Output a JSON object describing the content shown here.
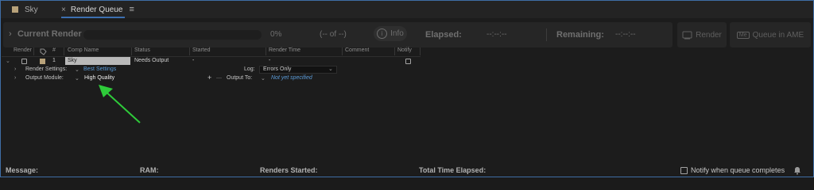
{
  "tabs": [
    {
      "label": "Sky"
    },
    {
      "label": "Render Queue"
    }
  ],
  "current_render": {
    "title": "Current Render",
    "percent": "0%",
    "of": "(-- of --)",
    "info_label": "Info",
    "elapsed_label": "Elapsed:",
    "elapsed_value": "--:--:--",
    "remaining_label": "Remaining:",
    "remaining_value": "--:--:--"
  },
  "actions": {
    "render_label": "Render",
    "ame_label": "Queue in AME",
    "ame_badge": "Me"
  },
  "table": {
    "columns": [
      "Render",
      "#",
      "Comp Name",
      "Status",
      "Started",
      "Render Time",
      "Comment",
      "Notify"
    ],
    "rows": [
      {
        "index": "1",
        "comp_name": "Sky",
        "status": "Needs Output",
        "started": "-",
        "render_time": "-",
        "comment": ""
      }
    ]
  },
  "render_settings": {
    "label": "Render Settings:",
    "value": "Best Settings",
    "log_label": "Log:",
    "log_value": "Errors Only"
  },
  "output_module": {
    "label": "Output Module:",
    "value": "High Quality",
    "output_to_label": "Output To:",
    "output_to_value": "Not yet specified"
  },
  "status_bar": {
    "message_label": "Message:",
    "ram_label": "RAM:",
    "renders_started_label": "Renders Started:",
    "total_time_label": "Total Time Elapsed:",
    "notify_label": "Notify when queue completes"
  },
  "colors": {
    "accent": "#3c6fb0",
    "link": "#5b9bd8",
    "label_color": "#b8a27a",
    "arrow": "#2ecb3a"
  },
  "icons": [
    "tag-icon",
    "info-icon",
    "render-icon",
    "bell-icon",
    "chevron-right-icon",
    "chevron-down-icon",
    "plus-icon",
    "hamburger-menu-icon",
    "close-icon"
  ]
}
